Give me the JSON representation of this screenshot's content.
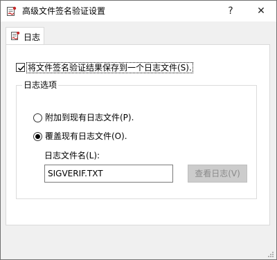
{
  "window": {
    "title": "高级文件签名验证设置",
    "help_glyph": "?",
    "close_glyph": "✕",
    "icon": "signature-verify-icon"
  },
  "tabs": [
    {
      "label": "日志",
      "icon": "log-icon",
      "selected": true
    }
  ],
  "logging": {
    "save_to_log_label": "将文件签名验证结果保存到一个日志文件(S).",
    "save_to_log_checked": true
  },
  "log_options": {
    "group_title": "日志选项",
    "append_label": "附加到现有日志文件(P).",
    "append_selected": false,
    "overwrite_label": "覆盖现有日志文件(O).",
    "overwrite_selected": true,
    "filename_label": "日志文件名(L):",
    "filename_value": "SIGVERIF.TXT",
    "view_log_label": "查看日志(V)",
    "view_log_enabled": false
  },
  "colors": {
    "titlebar": "#ffffff",
    "window_bg": "#f0f0f0",
    "panel_bg": "#ffffff",
    "disabled_button_bg": "#cccccc",
    "disabled_text": "#8a8a8a"
  }
}
